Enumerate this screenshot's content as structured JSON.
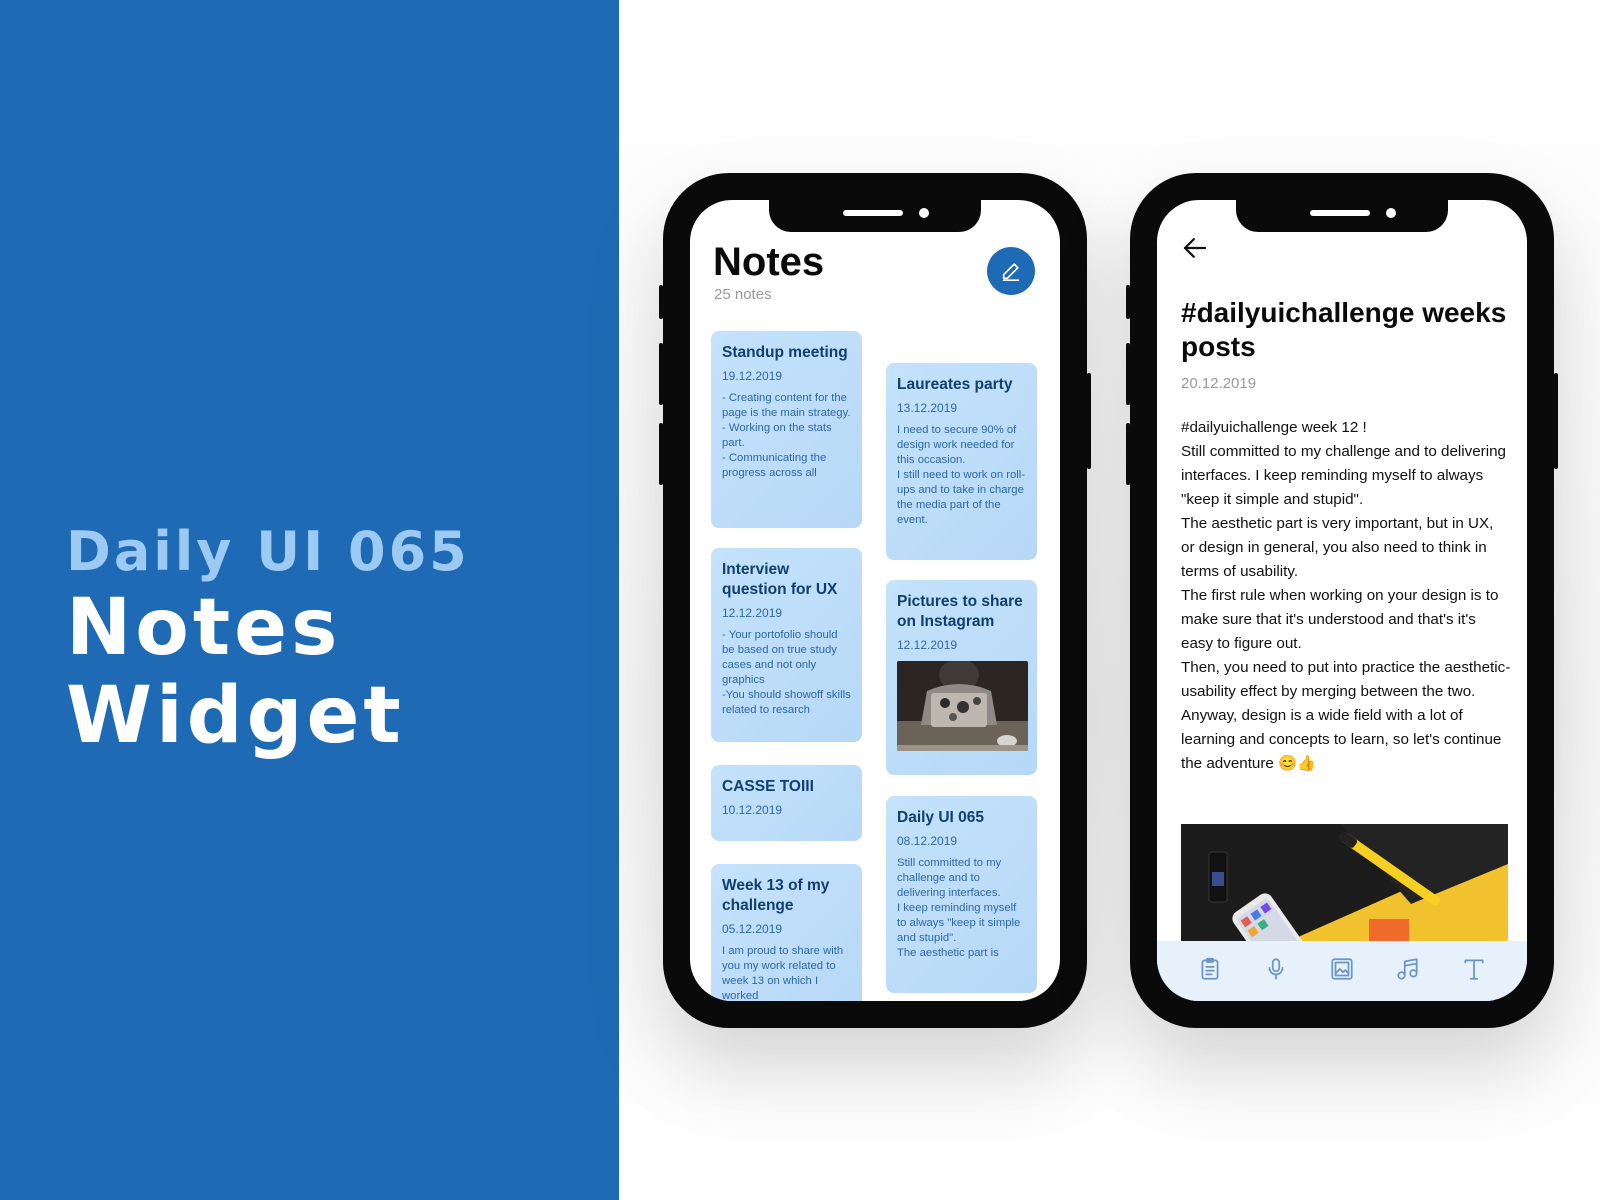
{
  "branding": {
    "subtitle": "Daily UI 065",
    "title_line1": "Notes",
    "title_line2": "Widget"
  },
  "colors": {
    "brand_blue": "#1e6ab4",
    "light_blue_text": "#9ccaf3",
    "card_bg": "#c4e2fb",
    "card_title": "#0f3f70",
    "card_text": "#2d67a3",
    "toolbar_bg": "#e6f1fb",
    "icon_blue": "#6b95c4"
  },
  "notes_screen": {
    "title": "Notes",
    "count": "25 notes",
    "new_note_icon": "pencil-icon",
    "left_column": [
      {
        "title": "Standup meeting",
        "date": "19.12.2019",
        "body": "- Creating content for the page is the main strategy.\n- Working on the stats part.\n- Communicating the progress across all"
      },
      {
        "title": "Interview question for UX",
        "date": "12.12.2019",
        "body": "- Your portofolio should be based on true study cases and not only graphics\n-You should showoff skills related to resarch"
      },
      {
        "title": "CASSE TOIII",
        "date": "10.12.2019",
        "body": ""
      },
      {
        "title": "Week 13 of my challenge",
        "date": "05.12.2019",
        "body": "I am proud to share with you my work related to week 13 on which I worked"
      }
    ],
    "right_column": [
      {
        "title": "Laureates party",
        "date": "13.12.2019",
        "body": "I need to secure 90% of design work needed for this occasion.\nI still need to work on roll-ups and to take in charge the media part of the event."
      },
      {
        "title": "Pictures to share on Instagram",
        "date": "12.12.2019",
        "body": "",
        "has_image": true
      },
      {
        "title": "Daily UI 065",
        "date": "08.12.2019",
        "body": "Still committed to my challenge and to delivering interfaces.\nI keep reminding myself to always \"keep it simple and stupid\".\nThe aesthetic part is"
      }
    ]
  },
  "detail_screen": {
    "back_icon": "arrow-left-icon",
    "title": "#dailyuichallenge weeks posts",
    "date": "20.12.2019",
    "body": "#dailyuichallenge week 12 !\nStill committed to my challenge and to delivering interfaces. I keep reminding myself to always \"keep it simple and stupid\".\nThe aesthetic part is very important, but in UX, or design in general, you also need to think in terms of usability.\nThe first rule when working on your design is to make sure that it's understood and that's it's easy to figure out.\nThen, you need to put into practice the aesthetic-usability effect by merging between the two.\nAnyway, design is a wide field with a lot of learning and concepts to learn, so let's continue the adventure 😊👍",
    "toolbar": [
      {
        "icon": "clipboard-icon",
        "name": "clipboard"
      },
      {
        "icon": "microphone-icon",
        "name": "microphone"
      },
      {
        "icon": "image-icon",
        "name": "image"
      },
      {
        "icon": "music-icon",
        "name": "music"
      },
      {
        "icon": "text-icon",
        "name": "text"
      }
    ]
  }
}
